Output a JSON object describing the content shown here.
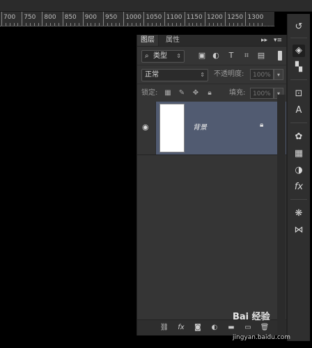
{
  "ruler": {
    "labels": [
      "700",
      "750",
      "800",
      "850",
      "900",
      "950",
      "1000",
      "1050",
      "1100",
      "1150",
      "1200",
      "1250",
      "1300"
    ]
  },
  "tabs": {
    "layers": "图层",
    "properties": "属性",
    "collapse": "▸▸",
    "menu": "▾≡"
  },
  "filter": {
    "kind_label": "类型",
    "icons": [
      "image-filter-icon",
      "adjustment-filter-icon",
      "text-filter-icon",
      "shape-filter-icon",
      "smart-object-filter-icon"
    ]
  },
  "blend": {
    "mode": "正常",
    "opacity_label": "不透明度:",
    "opacity_value": "100%"
  },
  "lock": {
    "label": "锁定:",
    "fill_label": "填充:",
    "fill_value": "100%"
  },
  "layer": {
    "name": "背景"
  },
  "watermark": {
    "text": "Bai 经验",
    "url": "jingyan.baidu.com"
  },
  "colors": {
    "selected_layer": "#515b71",
    "panel": "#353535"
  }
}
